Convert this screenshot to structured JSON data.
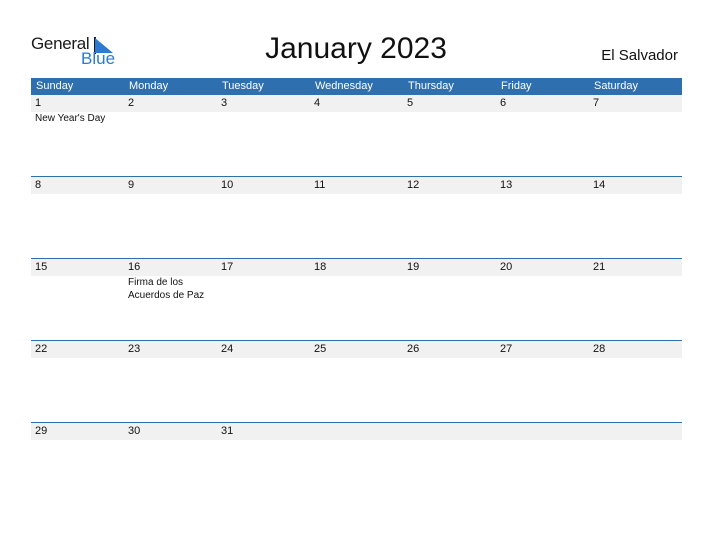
{
  "logo": {
    "general": "General",
    "blue": "Blue"
  },
  "title": "January 2023",
  "country": "El Salvador",
  "weekdays": [
    "Sunday",
    "Monday",
    "Tuesday",
    "Wednesday",
    "Thursday",
    "Friday",
    "Saturday"
  ],
  "weeks": [
    {
      "days": [
        "1",
        "2",
        "3",
        "4",
        "5",
        "6",
        "7"
      ],
      "events": [
        "New Year's Day",
        "",
        "",
        "",
        "",
        "",
        ""
      ]
    },
    {
      "days": [
        "8",
        "9",
        "10",
        "11",
        "12",
        "13",
        "14"
      ],
      "events": [
        "",
        "",
        "",
        "",
        "",
        "",
        ""
      ]
    },
    {
      "days": [
        "15",
        "16",
        "17",
        "18",
        "19",
        "20",
        "21"
      ],
      "events": [
        "",
        "Firma de los Acuerdos de Paz",
        "",
        "",
        "",
        "",
        ""
      ]
    },
    {
      "days": [
        "22",
        "23",
        "24",
        "25",
        "26",
        "27",
        "28"
      ],
      "events": [
        "",
        "",
        "",
        "",
        "",
        "",
        ""
      ]
    },
    {
      "days": [
        "29",
        "30",
        "31",
        "",
        "",
        "",
        ""
      ],
      "events": [
        "",
        "",
        "",
        "",
        "",
        "",
        ""
      ]
    }
  ],
  "colors": {
    "accent": "#2e6fb0",
    "logo_blue": "#2b7bd3",
    "day_row_bg": "#f1f1f1"
  }
}
